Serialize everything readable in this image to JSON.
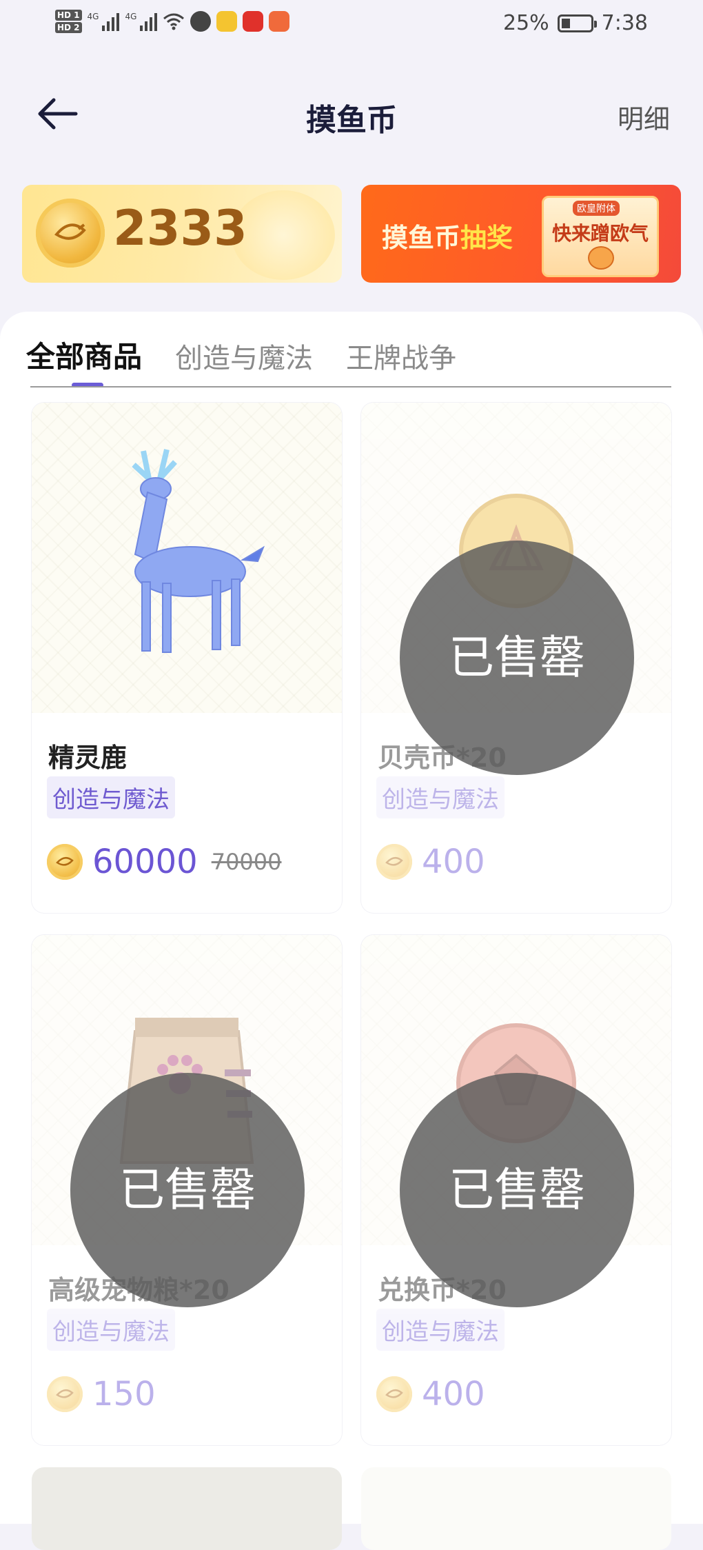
{
  "status_bar": {
    "hd1": "HD 1",
    "hd2": "HD 2",
    "net1": "4G",
    "net2": "4G",
    "battery_percent": "25%",
    "time": "7:38"
  },
  "header": {
    "title": "摸鱼币",
    "detail_label": "明细"
  },
  "banners": {
    "balance": "2333",
    "lottery_prefix": "摸鱼币",
    "lottery_highlight": "抽奖",
    "lottery_badge": "欧皇附体",
    "lottery_cta": "快来蹭欧气"
  },
  "tabs": [
    {
      "label": "全部商品",
      "active": true
    },
    {
      "label": "创造与魔法",
      "active": false
    },
    {
      "label": "王牌战争",
      "active": false
    }
  ],
  "products": [
    {
      "name": "精灵鹿",
      "tag": "创造与魔法",
      "price": "60000",
      "original_price": "70000",
      "sold_out": false
    },
    {
      "name": "贝壳币*20",
      "tag": "创造与魔法",
      "price": "400",
      "original_price": "",
      "sold_out": true
    },
    {
      "name": "高级宠物粮*20",
      "tag": "创造与魔法",
      "price": "150",
      "original_price": "",
      "sold_out": true
    },
    {
      "name": "兑换币*20",
      "tag": "创造与魔法",
      "price": "400",
      "original_price": "",
      "sold_out": true
    }
  ],
  "sold_out_label": "已售罄",
  "colors": {
    "accent": "#6b55d4",
    "tab_indicator": "#6b5dd6",
    "sold_overlay": "#5a5a5a"
  }
}
